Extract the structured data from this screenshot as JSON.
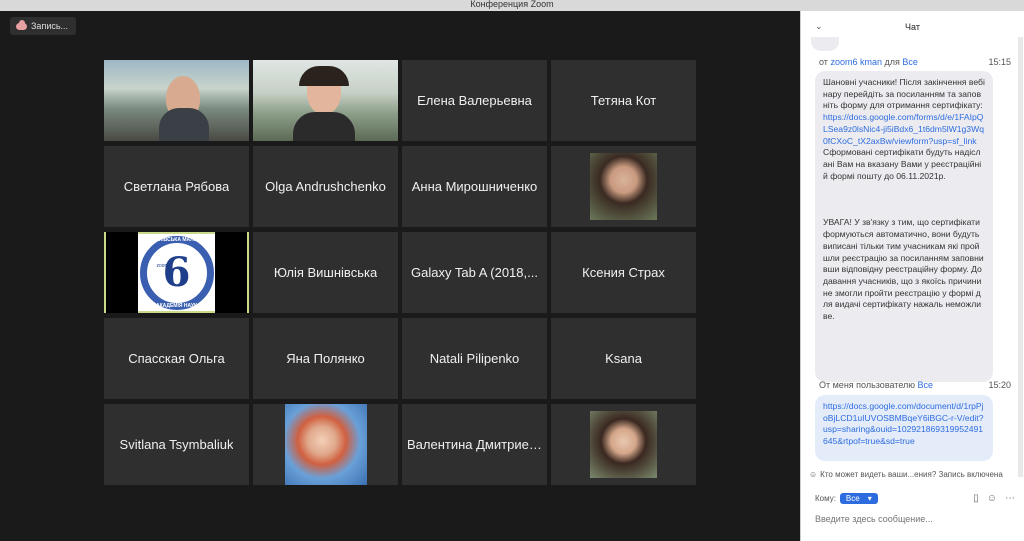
{
  "window": {
    "title": "Конференция Zoom"
  },
  "recording": {
    "label": "Запись..."
  },
  "participants": [
    {
      "kind": "video",
      "name": ""
    },
    {
      "kind": "video",
      "name": ""
    },
    {
      "kind": "name",
      "name": "Елена Валерьевна"
    },
    {
      "kind": "name",
      "name": "Тетяна Кот"
    },
    {
      "kind": "name",
      "name": "Светлана Рябова"
    },
    {
      "kind": "name",
      "name": "Olga Andrushchenko"
    },
    {
      "kind": "name",
      "name": "Анна Мирошниченко"
    },
    {
      "kind": "avatar",
      "name": ""
    },
    {
      "kind": "logo",
      "name": ""
    },
    {
      "kind": "name",
      "name": "Юлія Вишнівська"
    },
    {
      "kind": "name",
      "name": "Galaxy Tab A (2018,..."
    },
    {
      "kind": "name",
      "name": "Ксения Страх"
    },
    {
      "kind": "name",
      "name": "Спасская Ольга"
    },
    {
      "kind": "name",
      "name": "Яна Полянко"
    },
    {
      "kind": "name",
      "name": "Natali Pilipenko"
    },
    {
      "kind": "name",
      "name": "Ksana"
    },
    {
      "kind": "name",
      "name": "Svitlana Tsymbaliuk"
    },
    {
      "kind": "avatar",
      "name": ""
    },
    {
      "kind": "name",
      "name": "Валентина Дмитриевна"
    },
    {
      "kind": "avatar",
      "name": ""
    }
  ],
  "logo": {
    "digit": "6",
    "top_text": "КИЇВСЬКА МАЛА",
    "bottom_text": "АКАДЕМІЯ НАУК",
    "small": "zoom"
  },
  "chat": {
    "title": "Чат",
    "messages": [
      {
        "from_prefix": "от",
        "from": "zoom6 kman",
        "to_prefix": "для",
        "to": "Все",
        "time": "15:15",
        "text_a": "Шановні учасники! Після закінчення вебінару перейдіть за посиланням та заповніть форму для отримання сертифікату: ",
        "link": "https://docs.google.com/forms/d/e/1FAIpQLSea9z0lsNic4-ji5iBdx6_1t6dm5lW1g3Wq0fCXoC_tX2axBw/viewform?usp=sf_link",
        "text_b": " Сформовані сертифікати будуть надіслані Вам на вказану Вами у реєстраційній формі пошту до 06.11.2021р.\n\n\n\nУВАГА! У зв'язку з тим, що сертифікати формуються автоматично, вони будуть виписані тільки тим учасникам які пройшли реєстрацію за посиланням заповнивши відповідну реєстраційну форму. Додавання учасників, що з якоїсь причини не змогли пройти реєстрацію у формі для видачі сертифікату нажаль неможливе."
      },
      {
        "from_prefix": "От меня пользователю",
        "to": "Все",
        "time": "15:20",
        "link": "https://docs.google.com/document/d/1rpPjoBjLCD1uIUVOSBMBqeY6iBGC-r-V/edit?usp=sharing&ouid=102921869319952491645&rtpof=true&sd=true"
      }
    ],
    "who_can_see": "Кто может видеть ваши...ения? Запись включена",
    "to_label": "Кому:",
    "to_value": "Все",
    "input_placeholder": "Введите здесь сообщение..."
  }
}
